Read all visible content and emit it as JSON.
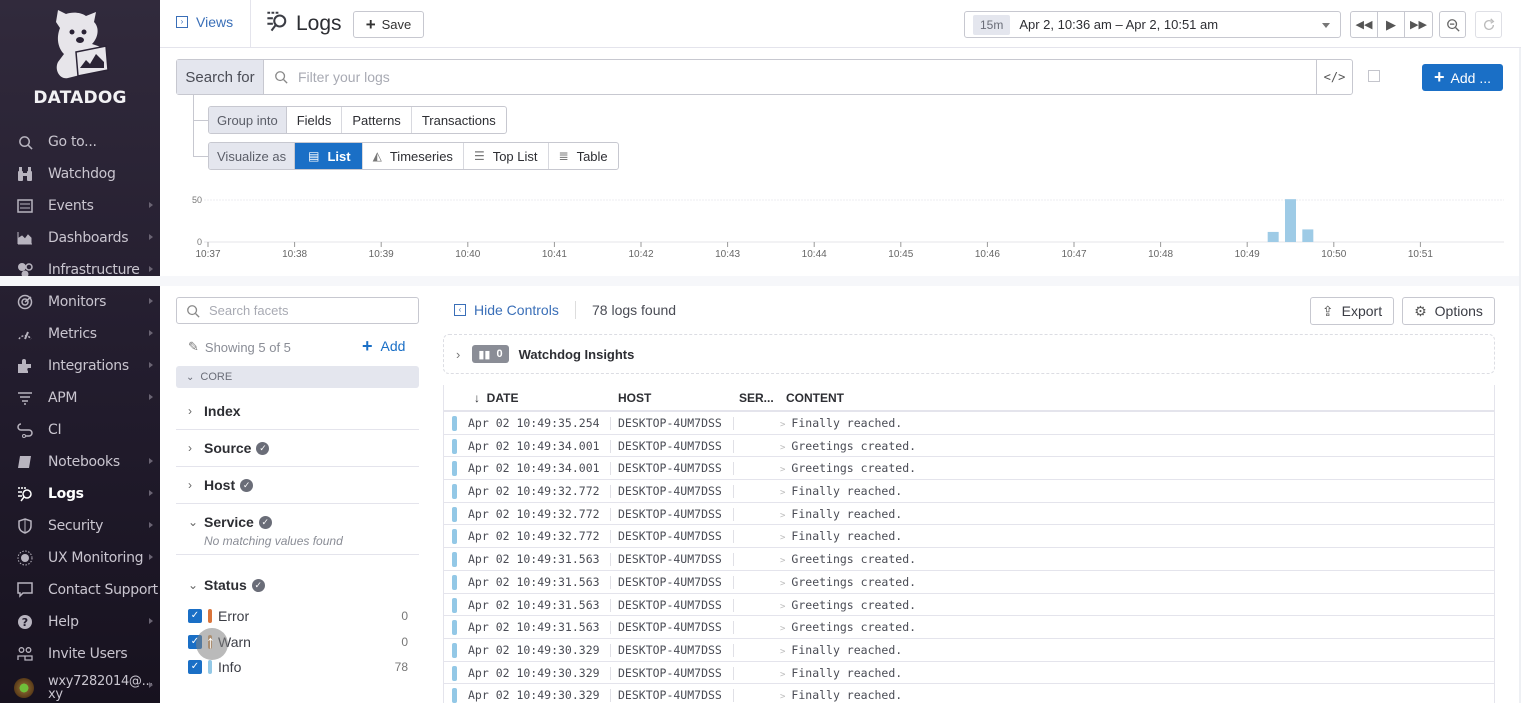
{
  "sidebar": {
    "brand": "DATADOG",
    "items": [
      {
        "label": "Go to...",
        "icon": "search-icon",
        "has_submenu": false
      },
      {
        "label": "Watchdog",
        "icon": "binoculars-icon",
        "has_submenu": false
      },
      {
        "label": "Events",
        "icon": "events-icon",
        "has_submenu": true
      },
      {
        "label": "Dashboards",
        "icon": "dashboards-icon",
        "has_submenu": true
      },
      {
        "label": "Infrastructure",
        "icon": "infrastructure-icon",
        "has_submenu": true
      },
      {
        "label": "Monitors",
        "icon": "monitors-icon",
        "has_submenu": true
      },
      {
        "label": "Metrics",
        "icon": "metrics-icon",
        "has_submenu": true
      },
      {
        "label": "Integrations",
        "icon": "puzzle-icon",
        "has_submenu": true
      },
      {
        "label": "APM",
        "icon": "apm-icon",
        "has_submenu": true
      },
      {
        "label": "CI",
        "icon": "ci-icon",
        "has_submenu": false
      },
      {
        "label": "Notebooks",
        "icon": "notebook-icon",
        "has_submenu": true
      },
      {
        "label": "Logs",
        "icon": "logs-icon",
        "has_submenu": true,
        "active": true
      },
      {
        "label": "Security",
        "icon": "shield-icon",
        "has_submenu": true
      },
      {
        "label": "UX Monitoring",
        "icon": "ux-monitoring-icon",
        "has_submenu": true
      },
      {
        "label": "Contact Support",
        "icon": "chat-icon",
        "has_submenu": false
      },
      {
        "label": "Help",
        "icon": "help-icon",
        "has_submenu": true
      },
      {
        "label": "Invite Users",
        "icon": "users-icon",
        "has_submenu": false
      }
    ],
    "user": {
      "name_line1": "wxy7282014@...",
      "name_line2": "xy"
    }
  },
  "header": {
    "views_label": "Views",
    "title": "Logs",
    "save_label": "Save",
    "time_badge": "15m",
    "time_range": "Apr 2, 10:36 am – Apr 2, 10:51 am"
  },
  "search": {
    "prefix": "Search for",
    "placeholder": "Filter your logs",
    "value": "",
    "code_label": "</>",
    "add_label": "Add ..."
  },
  "group_into": {
    "label": "Group into",
    "options": [
      "Fields",
      "Patterns",
      "Transactions"
    ]
  },
  "visualize_as": {
    "label": "Visualize as",
    "options": [
      {
        "label": "List",
        "icon": "list-icon",
        "active": true
      },
      {
        "label": "Timeseries",
        "icon": "timeseries-icon",
        "active": false
      },
      {
        "label": "Top List",
        "icon": "toplist-icon",
        "active": false
      },
      {
        "label": "Table",
        "icon": "table-icon",
        "active": false
      }
    ]
  },
  "histogram": {
    "y_ticks": [
      "0",
      "50"
    ],
    "y_max": 50,
    "x_ticks": [
      "10:37",
      "10:38",
      "10:39",
      "10:40",
      "10:41",
      "10:42",
      "10:43",
      "10:44",
      "10:45",
      "10:46",
      "10:47",
      "10:48",
      "10:49",
      "10:50",
      "10:51"
    ],
    "bars": [
      {
        "minute_offset": 12.3,
        "value": 12
      },
      {
        "minute_offset": 12.5,
        "value": 51
      },
      {
        "minute_offset": 12.7,
        "value": 15
      }
    ],
    "bar_color": "#9ecbe6"
  },
  "facets": {
    "search_placeholder": "Search facets",
    "showing": "Showing 5 of 5",
    "add_label": "Add",
    "core_label": "CORE",
    "groups": [
      {
        "name": "Index",
        "expanded": false,
        "verified": false
      },
      {
        "name": "Source",
        "expanded": false,
        "verified": true
      },
      {
        "name": "Host",
        "expanded": false,
        "verified": true
      },
      {
        "name": "Service",
        "expanded": true,
        "verified": true,
        "note": "No matching values found"
      },
      {
        "name": "Status",
        "expanded": true,
        "verified": true
      }
    ],
    "status_values": [
      {
        "label": "Error",
        "count": "0",
        "checked": true,
        "color": "#d9743a"
      },
      {
        "label": "Warn",
        "count": "0",
        "checked": true,
        "color": "#e0a060"
      },
      {
        "label": "Info",
        "count": "78",
        "checked": true,
        "color": "#93c8e6"
      }
    ]
  },
  "logs": {
    "hide_controls_label": "Hide Controls",
    "count_label": "78 logs found",
    "export_label": "Export",
    "options_label": "Options",
    "insights": {
      "count": "0",
      "title": "Watchdog Insights"
    },
    "columns": [
      "DATE",
      "HOST",
      "SER...",
      "CONTENT"
    ],
    "rows": [
      {
        "date": "Apr 02 10:49:35.254",
        "host": "DESKTOP-4UM7DSS",
        "service": "",
        "content": "Finally reached."
      },
      {
        "date": "Apr 02 10:49:34.001",
        "host": "DESKTOP-4UM7DSS",
        "service": "",
        "content": "Greetings created."
      },
      {
        "date": "Apr 02 10:49:34.001",
        "host": "DESKTOP-4UM7DSS",
        "service": "",
        "content": "Greetings created."
      },
      {
        "date": "Apr 02 10:49:32.772",
        "host": "DESKTOP-4UM7DSS",
        "service": "",
        "content": "Finally reached."
      },
      {
        "date": "Apr 02 10:49:32.772",
        "host": "DESKTOP-4UM7DSS",
        "service": "",
        "content": "Finally reached."
      },
      {
        "date": "Apr 02 10:49:32.772",
        "host": "DESKTOP-4UM7DSS",
        "service": "",
        "content": "Finally reached."
      },
      {
        "date": "Apr 02 10:49:31.563",
        "host": "DESKTOP-4UM7DSS",
        "service": "",
        "content": "Greetings created."
      },
      {
        "date": "Apr 02 10:49:31.563",
        "host": "DESKTOP-4UM7DSS",
        "service": "",
        "content": "Greetings created."
      },
      {
        "date": "Apr 02 10:49:31.563",
        "host": "DESKTOP-4UM7DSS",
        "service": "",
        "content": "Greetings created."
      },
      {
        "date": "Apr 02 10:49:31.563",
        "host": "DESKTOP-4UM7DSS",
        "service": "",
        "content": "Greetings created."
      },
      {
        "date": "Apr 02 10:49:30.329",
        "host": "DESKTOP-4UM7DSS",
        "service": "",
        "content": "Finally reached."
      },
      {
        "date": "Apr 02 10:49:30.329",
        "host": "DESKTOP-4UM7DSS",
        "service": "",
        "content": "Finally reached."
      },
      {
        "date": "Apr 02 10:49:30.329",
        "host": "DESKTOP-4UM7DSS",
        "service": "",
        "content": "Finally reached."
      }
    ]
  },
  "colors": {
    "accent": "#1a6fc6",
    "sidebar_bg": "#2a2335",
    "info": "#93c8e6"
  }
}
